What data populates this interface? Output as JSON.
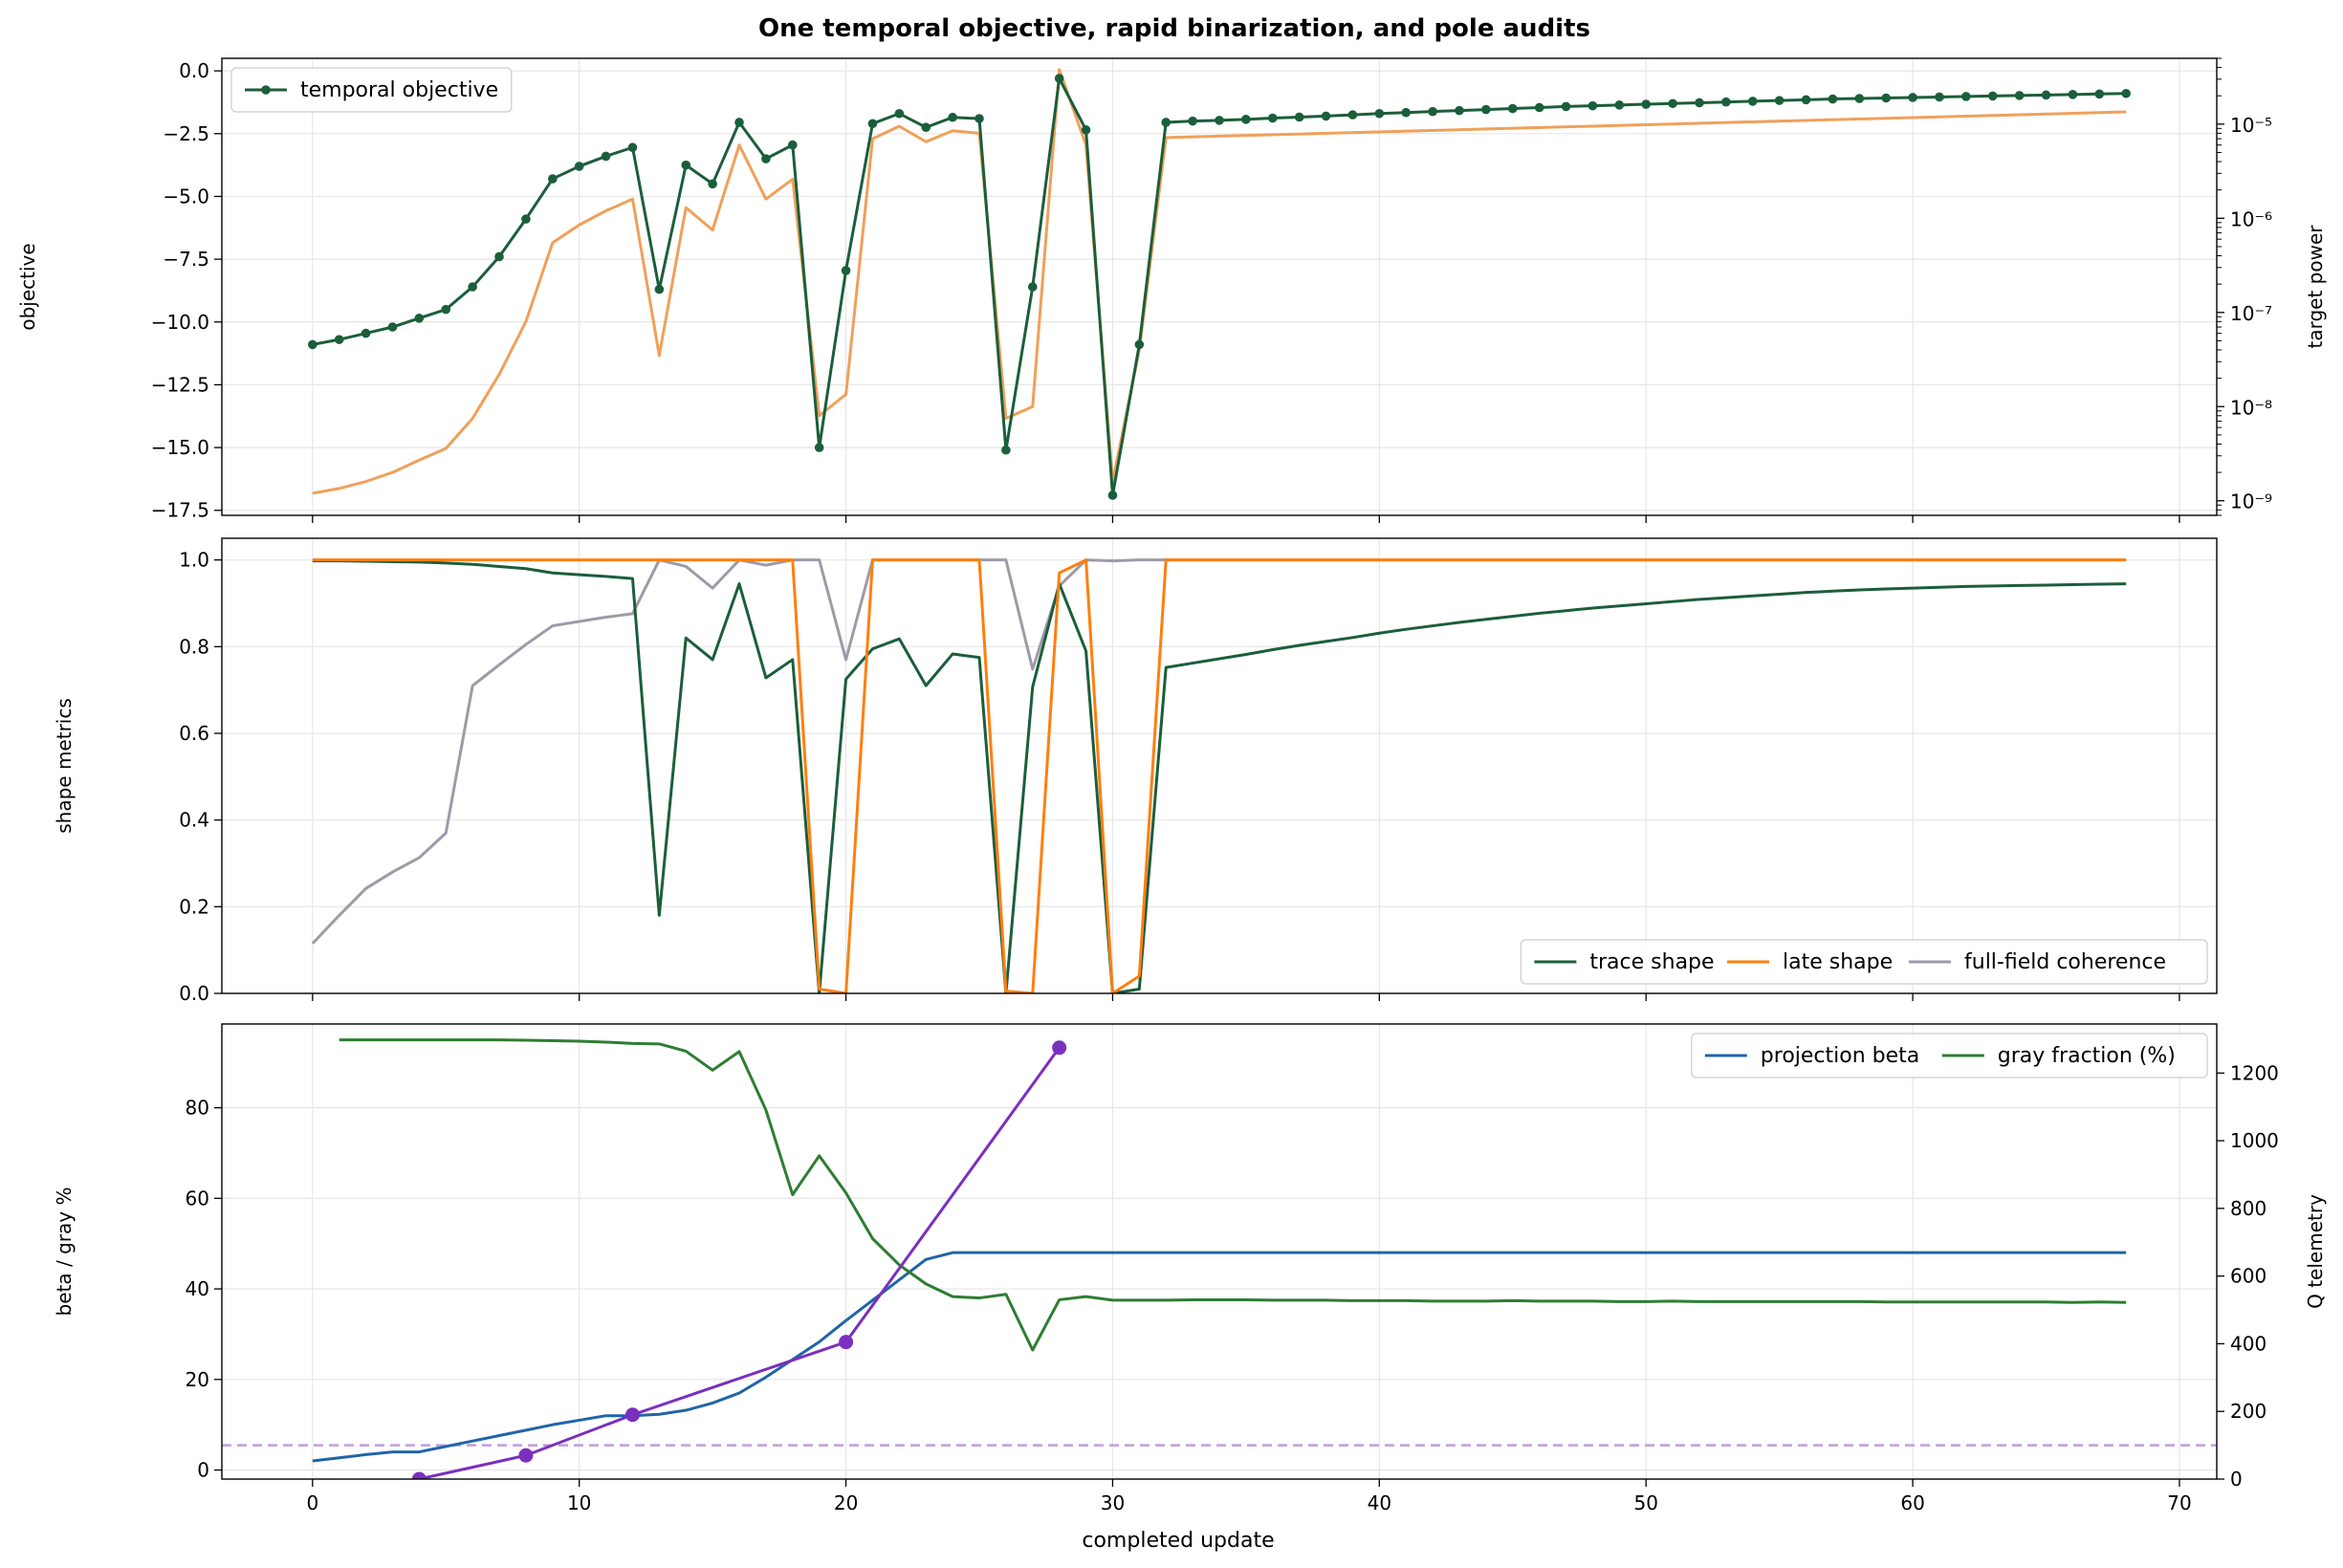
{
  "figure": {
    "title": "One temporal objective, rapid binarization, and pole audits",
    "xlabel": "completed update"
  },
  "colors": {
    "objective": "#1b5e3b",
    "target_power": "#f0a05a",
    "trace_shape": "#1b5e3b",
    "late_shape": "#ff7f0e",
    "coherence": "#9e9aa8",
    "beta": "#1f65a8",
    "gray": "#2e7d32",
    "q": "#7b2fbe",
    "q_threshold": "#c39be0"
  },
  "chart_data": [
    {
      "type": "line",
      "panel": "objective",
      "ylabel": "objective",
      "y2label": "target power",
      "y2scale": "log",
      "xlim": [
        -3.4,
        71.4
      ],
      "ylim": [
        -17.7,
        0.5
      ],
      "y2lim": [
        7e-10,
        5e-05
      ],
      "xticks": [
        "0",
        "10",
        "20",
        "30",
        "40",
        "50",
        "60",
        "70"
      ],
      "yticks": [
        "0.0",
        "−2.5",
        "−5.0",
        "−7.5",
        "−10.0",
        "−12.5",
        "−15.0",
        "−17.5"
      ],
      "y2ticks": [
        "10⁻⁹",
        "10⁻⁸",
        "10⁻⁷",
        "10⁻⁶",
        "10⁻⁵"
      ],
      "grid": true,
      "legend_position": "upper left",
      "series": [
        {
          "name": "temporal objective",
          "axis": "left",
          "marker": "circle",
          "x": [
            0,
            1,
            2,
            3,
            4,
            5,
            6,
            7,
            8,
            9,
            10,
            11,
            12,
            13,
            14,
            15,
            16,
            17,
            18,
            19,
            20,
            21,
            22,
            23,
            24,
            25,
            26,
            27,
            28,
            29,
            30,
            31,
            32,
            33,
            34,
            35,
            36,
            37,
            38,
            39,
            40,
            41,
            42,
            43,
            44,
            45,
            46,
            47,
            48,
            49,
            50,
            51,
            52,
            53,
            54,
            55,
            56,
            57,
            58,
            59,
            60,
            61,
            62,
            63,
            64,
            65,
            66,
            67,
            68
          ],
          "values": [
            -10.9,
            -10.7,
            -10.45,
            -10.2,
            -9.85,
            -9.5,
            -8.6,
            -7.4,
            -5.9,
            -4.3,
            -3.8,
            -3.4,
            -3.05,
            -8.7,
            -3.75,
            -4.5,
            -2.05,
            -3.5,
            -2.95,
            -15.0,
            -7.95,
            -2.1,
            -1.7,
            -2.25,
            -1.85,
            -1.9,
            -15.1,
            -8.6,
            -0.3,
            -2.35,
            -16.9,
            -10.9,
            -2.05,
            -2.0,
            -1.97,
            -1.93,
            -1.88,
            -1.84,
            -1.8,
            -1.75,
            -1.7,
            -1.66,
            -1.62,
            -1.58,
            -1.54,
            -1.5,
            -1.46,
            -1.42,
            -1.39,
            -1.36,
            -1.33,
            -1.3,
            -1.27,
            -1.24,
            -1.21,
            -1.18,
            -1.15,
            -1.12,
            -1.1,
            -1.08,
            -1.06,
            -1.04,
            -1.02,
            -1.0,
            -0.98,
            -0.96,
            -0.94,
            -0.92,
            -0.9
          ]
        },
        {
          "name": "",
          "axis": "right",
          "x": [
            0,
            1,
            2,
            3,
            4,
            5,
            6,
            7,
            8,
            9,
            10,
            11,
            12,
            13,
            14,
            15,
            16,
            17,
            18,
            19,
            20,
            21,
            22,
            23,
            24,
            25,
            26,
            27,
            28,
            29,
            30,
            31,
            32,
            68
          ],
          "values": [
            1.2e-09,
            1.35e-09,
            1.6e-09,
            2e-09,
            2.7e-09,
            3.6e-09,
            7.5e-09,
            2.2e-08,
            8e-08,
            5.5e-07,
            8.5e-07,
            1.2e-06,
            1.6e-06,
            3.5e-08,
            1.3e-06,
            7.5e-07,
            6e-06,
            1.6e-06,
            2.6e-06,
            8e-09,
            1.35e-08,
            7e-06,
            9.5e-06,
            6.5e-06,
            8.5e-06,
            8e-06,
            7.5e-09,
            1e-08,
            3.8e-05,
            6e-06,
            1.6e-09,
            4e-08,
            7.2e-06,
            1.35e-05
          ]
        }
      ]
    },
    {
      "type": "line",
      "panel": "shape",
      "ylabel": "shape metrics",
      "xlim": [
        -3.4,
        71.4
      ],
      "ylim": [
        0.0,
        1.05
      ],
      "yticks": [
        "0.0",
        "0.2",
        "0.4",
        "0.6",
        "0.8",
        "1.0"
      ],
      "grid": true,
      "legend_position": "lower right",
      "series": [
        {
          "name": "trace shape",
          "x": [
            0,
            1,
            2,
            3,
            4,
            5,
            6,
            7,
            8,
            9,
            10,
            11,
            12,
            13,
            14,
            15,
            16,
            17,
            18,
            19,
            20,
            21,
            22,
            23,
            24,
            25,
            26,
            27,
            28,
            29,
            30,
            31,
            32,
            33,
            34,
            35,
            36,
            37,
            38,
            39,
            40,
            41,
            42,
            43,
            44,
            45,
            46,
            47,
            48,
            49,
            50,
            51,
            52,
            53,
            54,
            55,
            56,
            57,
            58,
            59,
            60,
            61,
            62,
            63,
            64,
            65,
            66,
            67,
            68
          ],
          "values": [
            0.998,
            0.998,
            0.997,
            0.996,
            0.995,
            0.993,
            0.99,
            0.985,
            0.98,
            0.97,
            0.966,
            0.962,
            0.957,
            0.18,
            0.82,
            0.77,
            0.945,
            0.728,
            0.77,
            0.0,
            0.725,
            0.795,
            0.818,
            0.71,
            0.783,
            0.775,
            0.0,
            0.707,
            0.945,
            0.79,
            0.0,
            0.01,
            0.752,
            0.762,
            0.772,
            0.782,
            0.793,
            0.803,
            0.812,
            0.821,
            0.831,
            0.84,
            0.848,
            0.856,
            0.863,
            0.87,
            0.877,
            0.883,
            0.889,
            0.894,
            0.899,
            0.904,
            0.909,
            0.913,
            0.917,
            0.921,
            0.925,
            0.928,
            0.931,
            0.933,
            0.935,
            0.937,
            0.939,
            0.94,
            0.941,
            0.942,
            0.943,
            0.944,
            0.945
          ]
        },
        {
          "name": "late shape",
          "x": [
            0,
            18,
            19,
            20,
            21,
            25,
            26,
            27,
            28,
            29,
            30,
            31,
            32,
            68
          ],
          "values": [
            1.0,
            1.0,
            0.01,
            0.0,
            1.0,
            1.0,
            0.005,
            0.0,
            0.97,
            1.0,
            0.0,
            0.04,
            1.0,
            1.0
          ]
        },
        {
          "name": "full-field coherence",
          "x": [
            0,
            1,
            2,
            3,
            4,
            5,
            6,
            7,
            8,
            9,
            10,
            11,
            12,
            13,
            14,
            15,
            16,
            17,
            18,
            19,
            20,
            21,
            22,
            23,
            24,
            25,
            26,
            27,
            28,
            29,
            30,
            31,
            32,
            68
          ],
          "values": [
            0.115,
            0.18,
            0.242,
            0.28,
            0.313,
            0.37,
            0.71,
            0.758,
            0.805,
            0.848,
            0.858,
            0.868,
            0.876,
            1.0,
            0.985,
            0.935,
            1.0,
            0.988,
            1.0,
            1.0,
            0.77,
            1.0,
            1.0,
            1.0,
            1.0,
            1.0,
            1.0,
            0.748,
            0.94,
            1.0,
            0.998,
            1.0,
            1.0,
            1.0
          ]
        }
      ]
    },
    {
      "type": "line",
      "panel": "beta",
      "ylabel": "beta / gray %",
      "y2label": "Q telemetry",
      "xlim": [
        -3.4,
        71.4
      ],
      "ylim": [
        -2.0,
        98.5
      ],
      "y2lim": [
        0,
        1345
      ],
      "yticks": [
        "0",
        "20",
        "40",
        "60",
        "80"
      ],
      "y2ticks": [
        "0",
        "200",
        "400",
        "600",
        "800",
        "1000",
        "1200"
      ],
      "grid": true,
      "legend_position": "upper right",
      "series": [
        {
          "name": "projection beta",
          "axis": "left",
          "x": [
            0,
            1,
            2,
            3,
            4,
            5,
            6,
            7,
            8,
            9,
            10,
            11,
            12,
            13,
            14,
            15,
            16,
            17,
            18,
            19,
            20,
            21,
            22,
            23,
            24,
            68
          ],
          "values": [
            2,
            2.7,
            3.4,
            4,
            4,
            5.2,
            6.4,
            7.6,
            8.8,
            10,
            11,
            12,
            12,
            12.3,
            13.2,
            14.8,
            17,
            20.5,
            24.4,
            28.3,
            33,
            37.5,
            42,
            46.5,
            48,
            48
          ]
        },
        {
          "name": "gray fraction (%)",
          "axis": "left",
          "x": [
            1,
            2,
            3,
            4,
            5,
            6,
            7,
            8,
            9,
            10,
            11,
            12,
            13,
            14,
            15,
            16,
            17,
            18,
            19,
            20,
            21,
            22,
            23,
            24,
            25,
            26,
            27,
            28,
            29,
            30,
            31,
            32,
            33,
            34,
            35,
            36,
            37,
            38,
            39,
            40,
            41,
            42,
            43,
            44,
            45,
            46,
            47,
            48,
            49,
            50,
            51,
            52,
            53,
            54,
            55,
            56,
            57,
            58,
            59,
            60,
            61,
            62,
            63,
            64,
            65,
            66,
            67,
            68
          ],
          "values": [
            95,
            95,
            95,
            95,
            95,
            95,
            95,
            94.9,
            94.8,
            94.7,
            94.5,
            94.2,
            94.1,
            92.5,
            88.3,
            92.4,
            79.5,
            60.8,
            69.4,
            61.2,
            51.1,
            45.3,
            41.1,
            38.3,
            38,
            38.8,
            26.5,
            37.6,
            38.3,
            37.5,
            37.5,
            37.5,
            37.6,
            37.6,
            37.6,
            37.5,
            37.5,
            37.5,
            37.4,
            37.4,
            37.4,
            37.3,
            37.3,
            37.3,
            37.4,
            37.3,
            37.3,
            37.3,
            37.2,
            37.2,
            37.3,
            37.2,
            37.2,
            37.2,
            37.2,
            37.2,
            37.2,
            37.2,
            37.1,
            37.1,
            37.1,
            37.1,
            37.1,
            37.1,
            37.1,
            37.0,
            37.1,
            37.0
          ]
        },
        {
          "name": "",
          "axis": "right",
          "marker": "circle",
          "x": [
            4,
            8,
            12,
            20,
            28
          ],
          "values": [
            0,
            70,
            190,
            405,
            1275
          ]
        }
      ],
      "threshold": {
        "axis": "right",
        "value": 100,
        "style": "dashed"
      }
    }
  ]
}
